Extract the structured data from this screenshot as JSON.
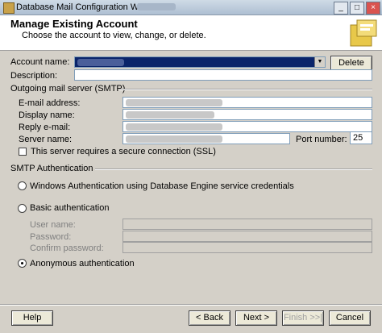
{
  "window": {
    "title": "Database Mail Configuration Wizard -",
    "min": "_",
    "max": "□",
    "close": "×"
  },
  "header": {
    "title": "Manage Existing Account",
    "subtitle": "Choose the account to view, change, or delete."
  },
  "account": {
    "name_label": "Account name:",
    "delete_label": "Delete",
    "description_label": "Description:",
    "description_value": ""
  },
  "smtp": {
    "group_label": "Outgoing mail server (SMTP)",
    "email_label": "E-mail address:",
    "display_label": "Display name:",
    "reply_label": "Reply e-mail:",
    "server_label": "Server name:",
    "port_label": "Port number:",
    "port_value": "25",
    "ssl_label": "This server requires a secure connection (SSL)"
  },
  "auth": {
    "group_label": "SMTP Authentication",
    "windows_label": "Windows Authentication using Database Engine service credentials",
    "basic_label": "Basic authentication",
    "user_label": "User name:",
    "password_label": "Password:",
    "confirm_label": "Confirm password:",
    "anonymous_label": "Anonymous authentication",
    "selected": "anonymous"
  },
  "footer": {
    "help": "Help",
    "back": "< Back",
    "next": "Next >",
    "finish": "Finish >>|",
    "cancel": "Cancel"
  },
  "colors": {
    "selection": "#0a246a",
    "face": "#d4d0c8"
  }
}
